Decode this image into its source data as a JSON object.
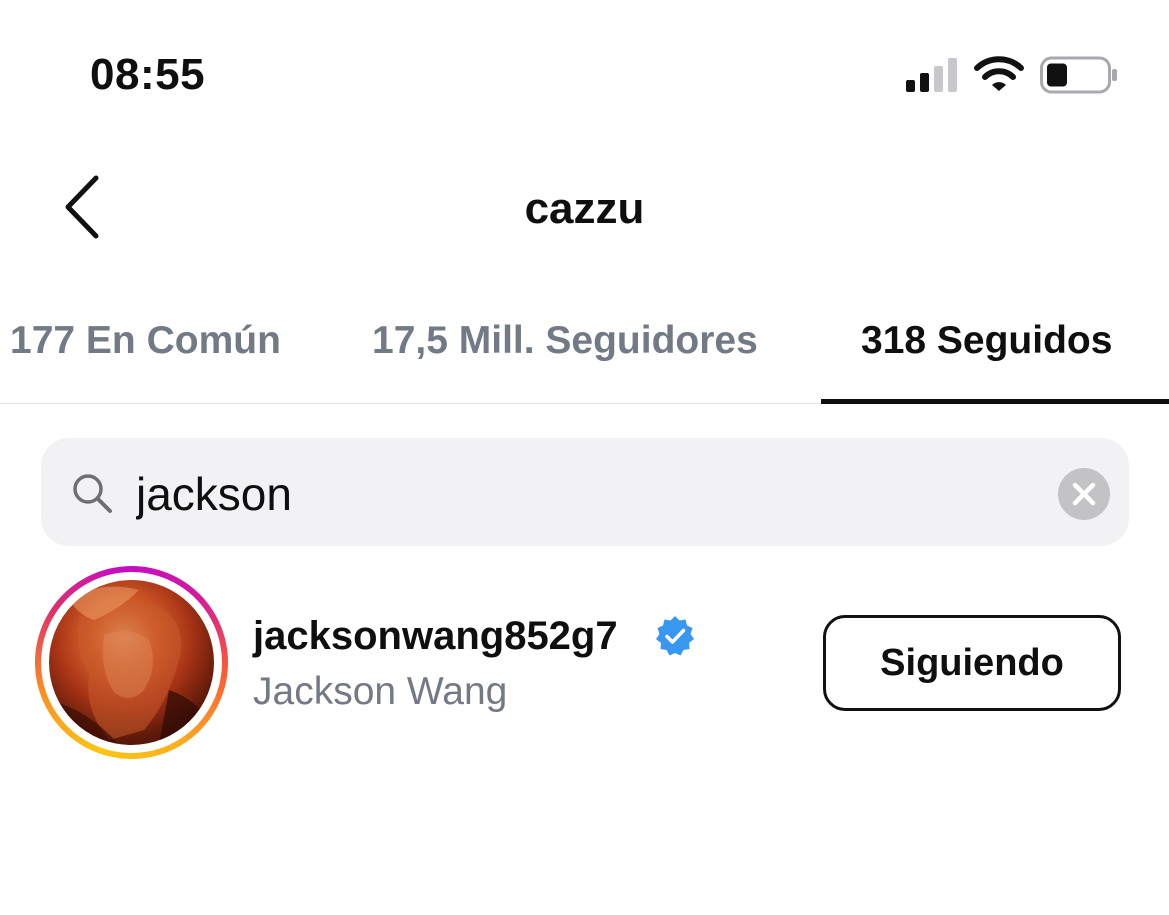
{
  "status_bar": {
    "time": "08:55",
    "icons": [
      "cellular-signal-icon",
      "wifi-icon",
      "battery-icon"
    ]
  },
  "header": {
    "title": "cazzu",
    "back_icon": "chevron-left-icon"
  },
  "tabs": [
    {
      "label": "177 En Común",
      "selected": false
    },
    {
      "label": "17,5 Mill. Seguidores",
      "selected": false
    },
    {
      "label": "318 Seguidos",
      "selected": true
    }
  ],
  "search": {
    "value": "jackson",
    "icon": "search-icon",
    "clear_icon": "clear-icon"
  },
  "results": [
    {
      "username": "jacksonwang852g7",
      "full_name": "Jackson Wang",
      "verified": true,
      "has_story": true,
      "button_label": "Siguiendo"
    }
  ],
  "colors": {
    "text_primary": "#0f0f0f",
    "text_secondary": "#737a85",
    "search_bg": "#f2f2f5",
    "verified_blue": "#3897f0"
  }
}
